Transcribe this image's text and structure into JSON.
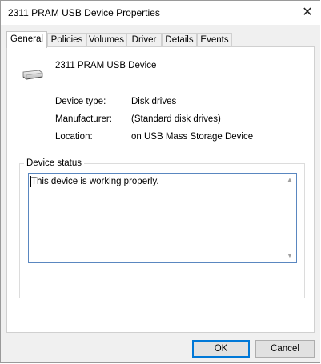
{
  "window": {
    "title": "2311 PRAM USB Device Properties"
  },
  "tabs": [
    {
      "label": "General"
    },
    {
      "label": "Policies"
    },
    {
      "label": "Volumes"
    },
    {
      "label": "Driver"
    },
    {
      "label": "Details"
    },
    {
      "label": "Events"
    }
  ],
  "active_tab": "General",
  "device": {
    "name": "2311 PRAM USB Device",
    "icon": "disk-drive-icon",
    "properties": [
      {
        "label": "Device type:",
        "value": "Disk drives"
      },
      {
        "label": "Manufacturer:",
        "value": "(Standard disk drives)"
      },
      {
        "label": "Location:",
        "value": "on USB Mass Storage Device"
      }
    ]
  },
  "status": {
    "legend": "Device status",
    "text": "This device is working properly."
  },
  "buttons": {
    "ok": "OK",
    "cancel": "Cancel"
  },
  "colors": {
    "accent": "#0078d7",
    "focus_border": "#5a87c0"
  }
}
